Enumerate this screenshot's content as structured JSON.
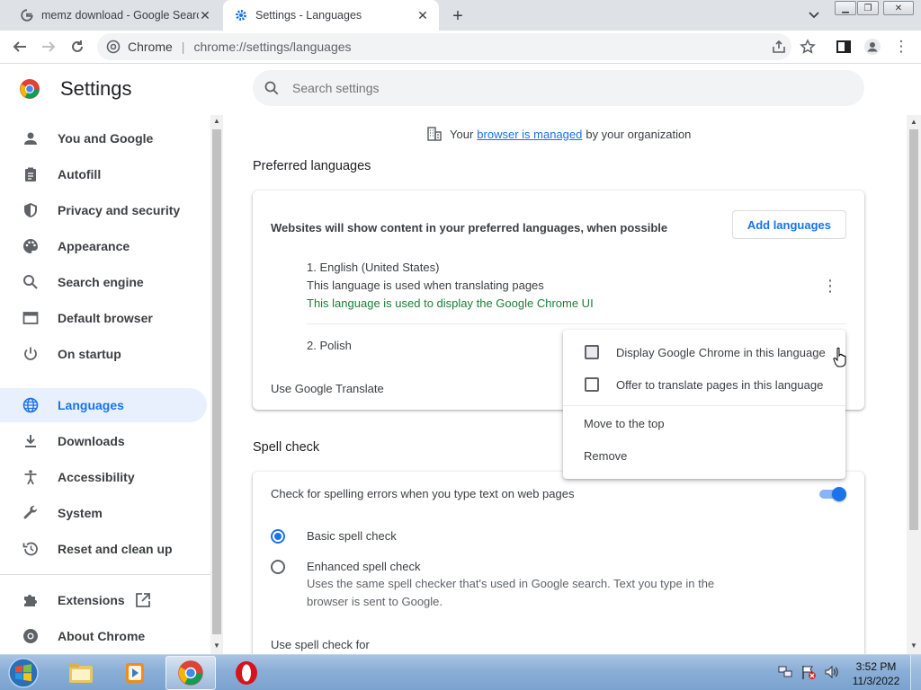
{
  "browser": {
    "tabs": [
      {
        "title": "memz download - Google Search",
        "favicon": "google-g-icon"
      },
      {
        "title": "Settings - Languages",
        "favicon": "gear-icon"
      }
    ],
    "window_controls": [
      "minimize",
      "restore",
      "close"
    ],
    "omnibox": {
      "site": "Chrome",
      "url": "chrome://settings/languages"
    }
  },
  "sidebar": {
    "title": "Settings",
    "items": [
      {
        "label": "You and Google",
        "icon": "person-icon"
      },
      {
        "label": "Autofill",
        "icon": "clipboard-icon"
      },
      {
        "label": "Privacy and security",
        "icon": "shield-icon"
      },
      {
        "label": "Appearance",
        "icon": "palette-icon"
      },
      {
        "label": "Search engine",
        "icon": "search-icon"
      },
      {
        "label": "Default browser",
        "icon": "browser-window-icon"
      },
      {
        "label": "On startup",
        "icon": "power-icon"
      },
      {
        "label": "Languages",
        "icon": "globe-icon",
        "active": true
      },
      {
        "label": "Downloads",
        "icon": "download-icon"
      },
      {
        "label": "Accessibility",
        "icon": "accessibility-icon"
      },
      {
        "label": "System",
        "icon": "wrench-icon"
      },
      {
        "label": "Reset and clean up",
        "icon": "history-icon"
      },
      {
        "label": "Extensions",
        "icon": "puzzle-icon"
      },
      {
        "label": "About Chrome",
        "icon": "chrome-icon"
      }
    ]
  },
  "search": {
    "placeholder": "Search settings"
  },
  "managed": {
    "prefix": "Your",
    "link": "browser is managed",
    "suffix": "by your organization"
  },
  "languages": {
    "section_title": "Preferred languages",
    "description": "Websites will show content in your preferred languages, when possible",
    "add_button": "Add languages",
    "list": [
      {
        "name": "1. English (United States)",
        "note1": "This language is used when translating pages",
        "note2": "This language is used to display the Google Chrome UI"
      },
      {
        "name": "2. Polish"
      }
    ],
    "translate_label": "Use Google Translate"
  },
  "spell_check": {
    "section_title": "Spell check",
    "toggle_label": "Check for spelling errors when you type text on web pages",
    "toggle_on": true,
    "options": [
      {
        "label": "Basic spell check",
        "selected": true
      },
      {
        "label": "Enhanced spell check",
        "selected": false,
        "sub": "Uses the same spell checker that's used in Google search. Text you type in the browser is sent to Google."
      }
    ],
    "use_for_label": "Use spell check for"
  },
  "context_menu": {
    "items": [
      {
        "label": "Display Google Chrome in this language",
        "checkbox": true,
        "checked": false
      },
      {
        "label": "Offer to translate pages in this language",
        "checkbox": true,
        "checked": false
      },
      {
        "label": "Move to the top"
      },
      {
        "label": "Remove"
      }
    ]
  },
  "taskbar": {
    "apps": [
      "windows-explorer-icon",
      "media-player-icon",
      "chrome-icon",
      "opera-icon"
    ],
    "clock_time": "3:52 PM",
    "clock_date": "11/3/2022"
  },
  "colors": {
    "accent": "#1a73e8",
    "green_text": "#188038",
    "active_nav_bg": "#e8f0fe"
  }
}
